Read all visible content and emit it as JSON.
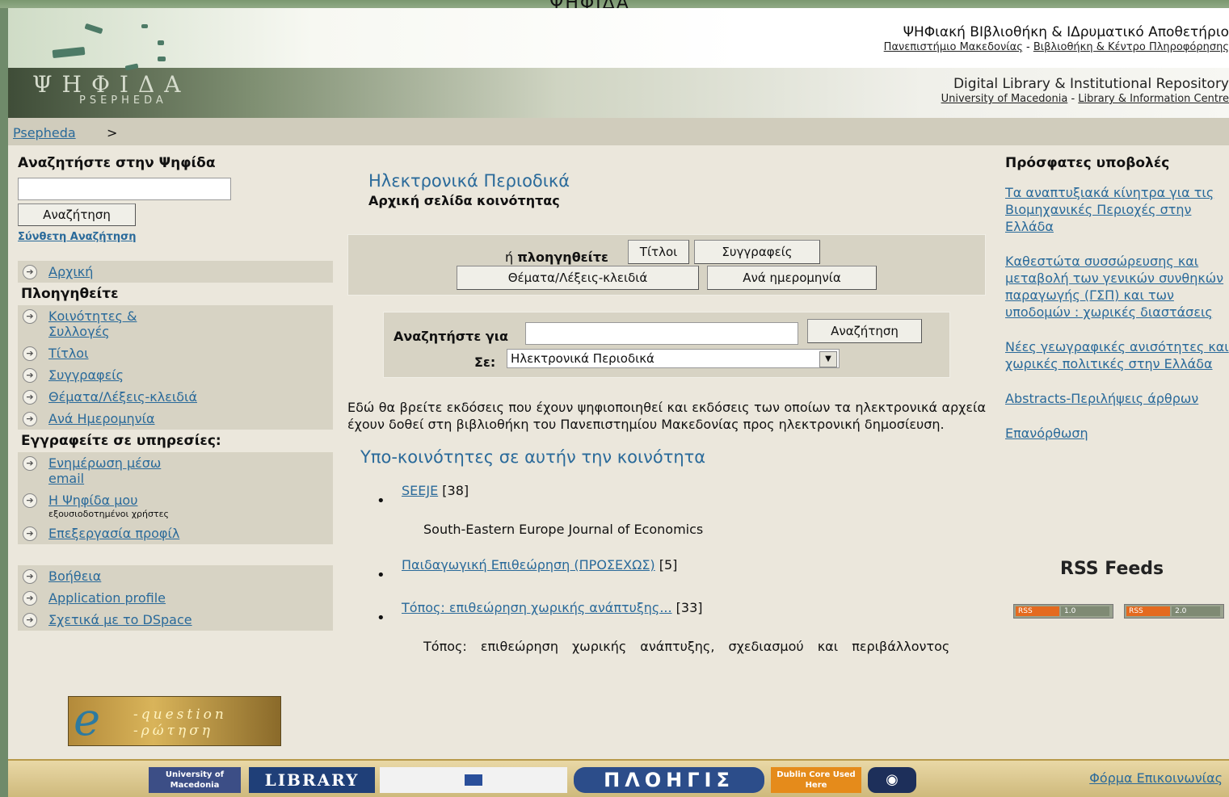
{
  "window_title": "ΨΗΦΙΔΑ",
  "header": {
    "logo_main": "ΨΗΦΙΔΑ",
    "logo_sub": "PSEPHEDA",
    "gr_title": "ΨΗΦιακή ΒΙβλιοθήκη & ΙΔρυματικό Αποθετήριο",
    "gr_univ": "Πανεπιστήμιο Μακεδονίας",
    "gr_sep": " - ",
    "gr_lib": "Βιβλιοθήκη & Κέντρο Πληροφόρησης",
    "en_title": "Digital Library & Institutional Repository",
    "en_univ": "University of Macedonia",
    "en_sep": " - ",
    "en_lib": "Library & Information Centre"
  },
  "breadcrumb": {
    "home": "Psepheda ",
    "sep": ">"
  },
  "sidebar": {
    "search_heading": "Αναζητήστε στην Ψηφίδα",
    "search_button": "Αναζήτηση",
    "advanced": "Σύνθετη Αναζήτηση",
    "home": "Αρχική",
    "browse_heading": "Πλοηγηθείτε",
    "browse_items": [
      "Κοινότητες & Συλλογές",
      "Τίτλοι",
      "Συγγραφείς",
      "Θέματα/Λέξεις-κλειδιά",
      "Ανά Ημερομηνία"
    ],
    "subscribe_heading": "Εγγραφείτε σε υπηρεσίες:",
    "sub_items": [
      "Ενημέρωση μέσω email",
      "Η Ψηφίδα μου",
      "Επεξεργασία προφίλ"
    ],
    "my_note": "εξουσιοδοτημένοι χρήστες",
    "help_items": [
      "Βοήθεια",
      "Application profile",
      "Σχετικά με το DSpace"
    ],
    "eq_line1": "-question",
    "eq_line2": "-ρώτηση"
  },
  "center": {
    "community_title": "Ηλεκτρονικά Περιοδικά",
    "community_sub": "Αρχική σελίδα κοινότητας",
    "browse_prefix": "ή ",
    "browse_bold": "πλοηγηθείτε",
    "btn_titles": "Τίτλοι",
    "btn_authors": "Συγγραφείς",
    "btn_subjects": "Θέματα/Λέξεις-κλειδιά",
    "btn_date": "Ανά ημερομηνία",
    "search_for": "Αναζητήστε για",
    "search_btn": "Αναζήτηση",
    "in_label": "Σε:",
    "scope_value": "Ηλεκτρονικά Περιοδικά",
    "description": "Εδώ θα βρείτε εκδόσεις που έχουν ψηφιοποιηθεί και εκδόσεις των οποίων τα ηλεκτρονικά αρχεία έχουν δοθεί στη βιβλιοθήκη του Πανεπιστημίου Μακεδονίας προς ηλεκτρονική δημοσίευση.",
    "subcommunities_heading": "Υπο-κοινότητες σε αυτήν την κοινότητα",
    "subcommunities": [
      {
        "name": "SEEJE",
        "count": " [38]",
        "desc": "South-Eastern Europe Journal of Economics"
      },
      {
        "name": "Παιδαγωγική Επιθεώρηση (ΠΡΟΣΕΧΩΣ)",
        "count": " [5]",
        "desc": ""
      },
      {
        "name": "Τόπος: επιθεώρηση χωρικής ανάπτυξης...",
        "count": " [33]",
        "desc": "Τόπος: επιθεώρηση χωρικής ανάπτυξης, σχεδιασμού και περιβάλλοντος"
      }
    ]
  },
  "right": {
    "recent_heading": "Πρόσφατες υποβολές",
    "recent": [
      "Τα αναπτυξιακά κίνητρα για τις Βιομηχανικές Περιοχές στην Ελλάδα",
      "Καθεστώτα συσσώρευσης και μεταβολή των γενικών συνθηκών παραγωγής (ΓΣΠ) και των υποδομών : χωρικές διαστάσεις",
      "Νέες γεωγραφικές ανισότητες και χωρικές πολιτικές στην Ελλάδα",
      "Abstracts-Περιλήψεις άρθρων",
      "Επανόρθωση"
    ],
    "rss_title": "RSS Feeds",
    "rss_label": "RSS",
    "rss_v1": "1.0",
    "rss_v2": "2.0"
  },
  "footer": {
    "uom": "University of Macedonia",
    "library": "LIBRARY",
    "plo": "ΠΛΟΗΓΙΣ",
    "dc": "Dublin Core Used Here",
    "contact": "Φόρμα Επικοινωνίας"
  }
}
